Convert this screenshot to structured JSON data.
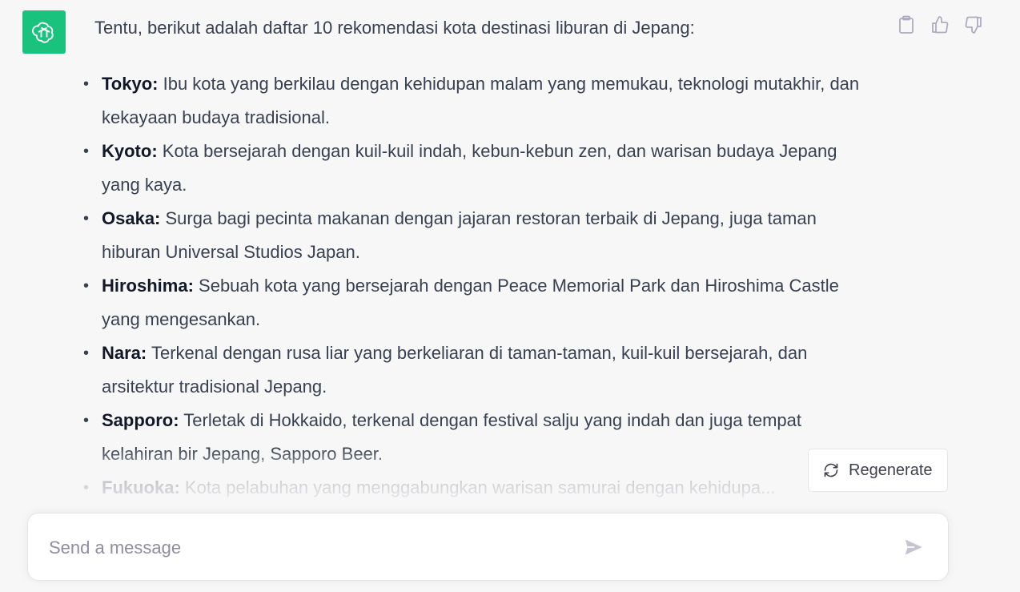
{
  "message": {
    "intro": "Tentu, berikut adalah daftar 10 rekomendasi kota destinasi liburan di Jepang:",
    "items": [
      {
        "name": "Tokyo:",
        "desc": " Ibu kota yang berkilau dengan kehidupan malam yang memukau, teknologi mutakhir, dan kekayaan budaya tradisional."
      },
      {
        "name": "Kyoto:",
        "desc": " Kota bersejarah dengan kuil-kuil indah, kebun-kebun zen, dan warisan budaya Jepang yang kaya."
      },
      {
        "name": "Osaka:",
        "desc": " Surga bagi pecinta makanan dengan jajaran restoran terbaik di Jepang, juga taman hiburan Universal Studios Japan."
      },
      {
        "name": "Hiroshima:",
        "desc": " Sebuah kota yang bersejarah dengan Peace Memorial Park dan Hiroshima Castle yang mengesankan."
      },
      {
        "name": "Nara:",
        "desc": " Terkenal dengan rusa liar yang berkeliaran di taman-taman, kuil-kuil bersejarah, dan arsitektur tradisional Jepang."
      },
      {
        "name": "Sapporo:",
        "desc": " Terletak di Hokkaido, terkenal dengan festival salju yang indah dan juga tempat kelahiran bir Jepang, Sapporo Beer."
      },
      {
        "name": "Fukuoka:",
        "desc": " Kota pelabuhan yang menggabungkan warisan samurai dengan kehidupa..."
      }
    ]
  },
  "icons": {
    "avatar": "openai-logo-icon",
    "copy": "clipboard-icon",
    "like": "thumbs-up-icon",
    "dislike": "thumbs-down-icon",
    "regenerate": "refresh-icon",
    "send": "paper-plane-icon"
  },
  "regenerate_label": "Regenerate",
  "input": {
    "placeholder": "Send a message",
    "value": ""
  },
  "colors": {
    "accent": "#19c37d",
    "background": "#f7f7f8",
    "text": "#374151"
  }
}
